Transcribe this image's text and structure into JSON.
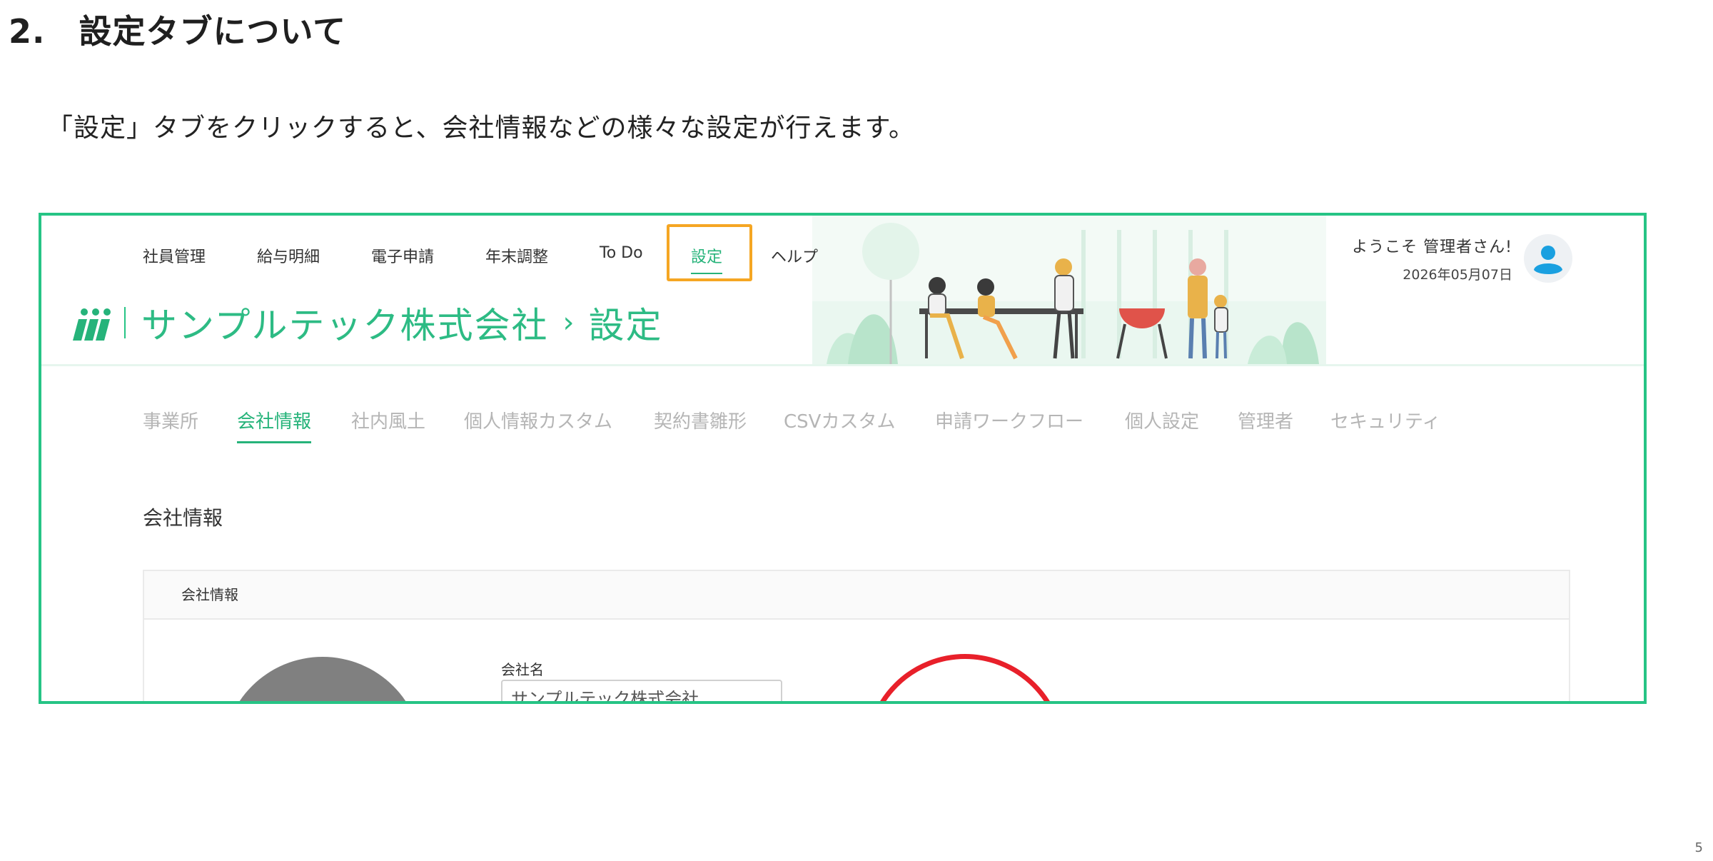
{
  "heading": "2.　設定タブについて",
  "intro": "「設定」タブをクリックすると、会社情報などの様々な設定が行えます。",
  "page_number": "5",
  "app": {
    "nav": [
      {
        "label": "社員管理",
        "active": false
      },
      {
        "label": "給与明細",
        "active": false
      },
      {
        "label": "電子申請",
        "active": false
      },
      {
        "label": "年末調整",
        "active": false
      },
      {
        "label": "To Do",
        "active": false
      },
      {
        "label": "設定",
        "active": true
      },
      {
        "label": "ヘルプ",
        "active": false
      }
    ],
    "brand": {
      "company": "サンプルテック株式会社",
      "arrow": "›",
      "current_page": "設定"
    },
    "user": {
      "welcome": "ようこそ 管理者さん!",
      "date": "2026年05月07日"
    },
    "sub_tabs": [
      {
        "label": "事業所",
        "active": false
      },
      {
        "label": "会社情報",
        "active": true
      },
      {
        "label": "社内風土",
        "active": false
      },
      {
        "label": "個人情報カスタム",
        "active": false
      },
      {
        "label": "契約書雛形",
        "active": false
      },
      {
        "label": "CSVカスタム",
        "active": false
      },
      {
        "label": "申請ワークフロー",
        "active": false
      },
      {
        "label": "個人設定",
        "active": false
      },
      {
        "label": "管理者",
        "active": false
      },
      {
        "label": "セキュリティ",
        "active": false
      }
    ],
    "section_title": "会社情報",
    "card": {
      "header": "会社情報",
      "field_label": "会社名",
      "field_value": "サンプルテック株式会社"
    }
  },
  "colors": {
    "brand_green": "#2dbb84",
    "frame_green": "#26c485",
    "highlight_orange": "#f5a623",
    "annotation_red": "#e8202a"
  }
}
